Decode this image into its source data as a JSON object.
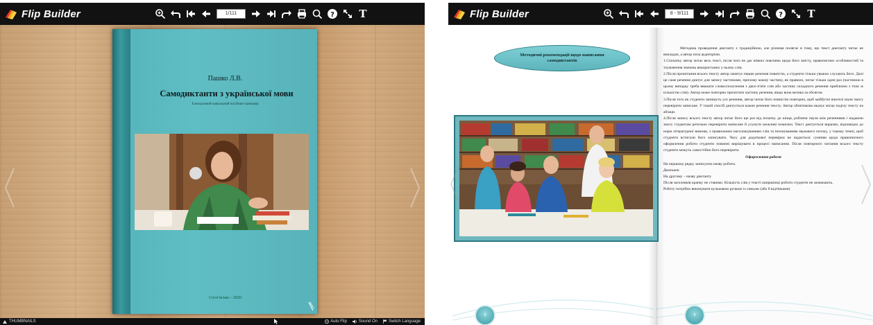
{
  "left_view": {
    "toolbar": {
      "brand": "Flip Builder",
      "page_field": "1/111",
      "icons": [
        "zoom-in-icon",
        "undo-icon",
        "first-page-icon",
        "prev-page-icon",
        "next-page-icon",
        "last-page-icon",
        "share-icon",
        "print-icon",
        "search-icon",
        "help-icon",
        "fullscreen-icon",
        "text-icon"
      ]
    },
    "cover": {
      "author": "Пашко Л.В.",
      "title": "Самодиктанти з української мови",
      "subtitle": "Електронний навчальний посібник-тренажер",
      "place_year": "Соснʼвська – 2020"
    },
    "bottom_bar": {
      "thumbnails": "THUMBNAILS",
      "auto_flip": "Auto Flip",
      "sound_on": "Sound On",
      "switch_language": "Switch Language"
    }
  },
  "right_view": {
    "toolbar": {
      "brand": "Flip Builder",
      "page_field": "8 - 9/111"
    },
    "left_page": {
      "oval_title": "Методичні рекомендації щодо написання самодиктантів",
      "page_number": "8"
    },
    "right_page": {
      "page_number": "9",
      "paragraphs": [
        {
          "cls": "indent",
          "text": "Методика проведення диктанту є традиційною, але різниця полягає в тому, що текст диктанту читає не викладач, а автор поза аудиторією."
        },
        {
          "cls": "",
          "text": "1.Спочатку автор читає весь текст, після чого не дає ніяких пояснень щодо його змісту, правописних особливостей та тлумачення значень використаних у ньому слів."
        },
        {
          "cls": "",
          "text": "2.Після прочитання всього тексту автор зачитує перше речення повністю, а студенти тільки уважно слухають його. Далі це саме речення диктує для запису частинами, причому кожну частину, як правило, читає тільки один раз (частиною в цьому випадку треба вважати словосполучення з двох-п'яти слів або частину складного речення приблизно з тією ж кількістю слів). Автор може повторно прочитати частину речення, якщо вона велика за обсягом."
        },
        {
          "cls": "",
          "text": "3.Після того як студенти запишуть усе речення, автор читає його повністю повторно, щоб майбутні вчителі мали змогу перевірити записане. У такий спосіб диктується кожне речення тексту. Автор обов'язково вказує місце поділу тексту на абзаци."
        },
        {
          "cls": "",
          "text": "4.Після запису всього тексту автор читає його ще раз від початку до кінця, роблячи паузи між реченнями і надаючи змогу студентам ретельно перевірити написане й усунути можливі помилки. Текст диктується виразно, відповідно до норм літературної вимови, з правильним наголошуванням слів та інтонуванням звукового потоку, у такому темпі, щоб студенти встигали його записувати. Часу для додаткової перевірки не надається: сумніви щодо правописного оформлення роботи студенти повинні вирішувати в процесі написання. Після повторного читання всього тексту студенти можуть самостійно його перевірити."
        },
        {
          "cls": "center-h",
          "text": "Оформлення роботи"
        },
        {
          "cls": "",
          "text": "На першому рядку записуємо назву роботи."
        },
        {
          "cls": "italic",
          "text": "Диктант"
        },
        {
          "cls": "",
          "text": "На другому – назву диктанту"
        },
        {
          "cls": "",
          "text": "Після заголовків крапку не ставимо. Кількість слів у тексті наприкінці роботи студенти не зазначають."
        },
        {
          "cls": "",
          "text": "Роботу потрібно виконувати кульковою ручкою із синьою (або 8 відтінками)"
        }
      ]
    }
  },
  "colors": {
    "toolbar_bg": "#121212",
    "cover_teal": "#5fbec4",
    "frame_teal": "#2a7880",
    "wood": "#c9a176"
  }
}
